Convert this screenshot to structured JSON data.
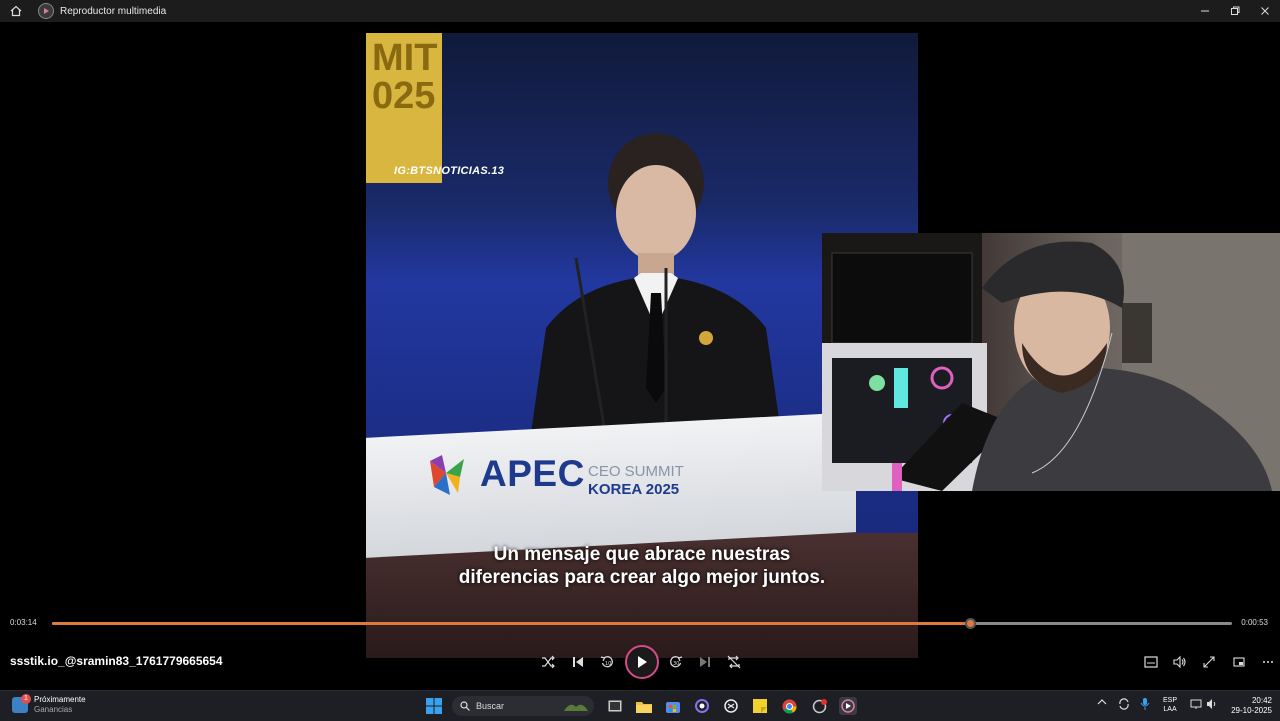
{
  "window": {
    "title": "Reproductor multimedia"
  },
  "video": {
    "watermark": "IG:BTSNOTICIAS.13",
    "banner_text": "MIT\n025",
    "podium_brand": "APEC",
    "podium_line1": "CEO SUMMIT",
    "podium_line2": "KOREA 2025",
    "subtitle_line1": "Un mensaje que abrace nuestras",
    "subtitle_line2": "diferencias para crear algo mejor juntos."
  },
  "player": {
    "current_time": "0:03:14",
    "total_time": "0:00:53",
    "progress": 0.778,
    "filename": "ssstik.io_@sramin83_1761779665654",
    "accent_color": "#e07a3a",
    "controls": [
      "shuffle-icon",
      "previous-icon",
      "rewind-10-icon",
      "play-icon",
      "forward-30-icon",
      "next-icon",
      "repeat-off-icon"
    ],
    "right_controls": [
      "subtitles-icon",
      "volume-icon",
      "fullscreen-icon",
      "miniplayer-icon",
      "more-icon"
    ]
  },
  "taskbar": {
    "widget_title": "Próximamente",
    "widget_sub": "Ganancias",
    "widget_badge": "1",
    "search_placeholder": "Buscar",
    "lang_line1": "ESP",
    "lang_line2": "LAA",
    "time": "20:42",
    "date": "29-10-2025"
  }
}
